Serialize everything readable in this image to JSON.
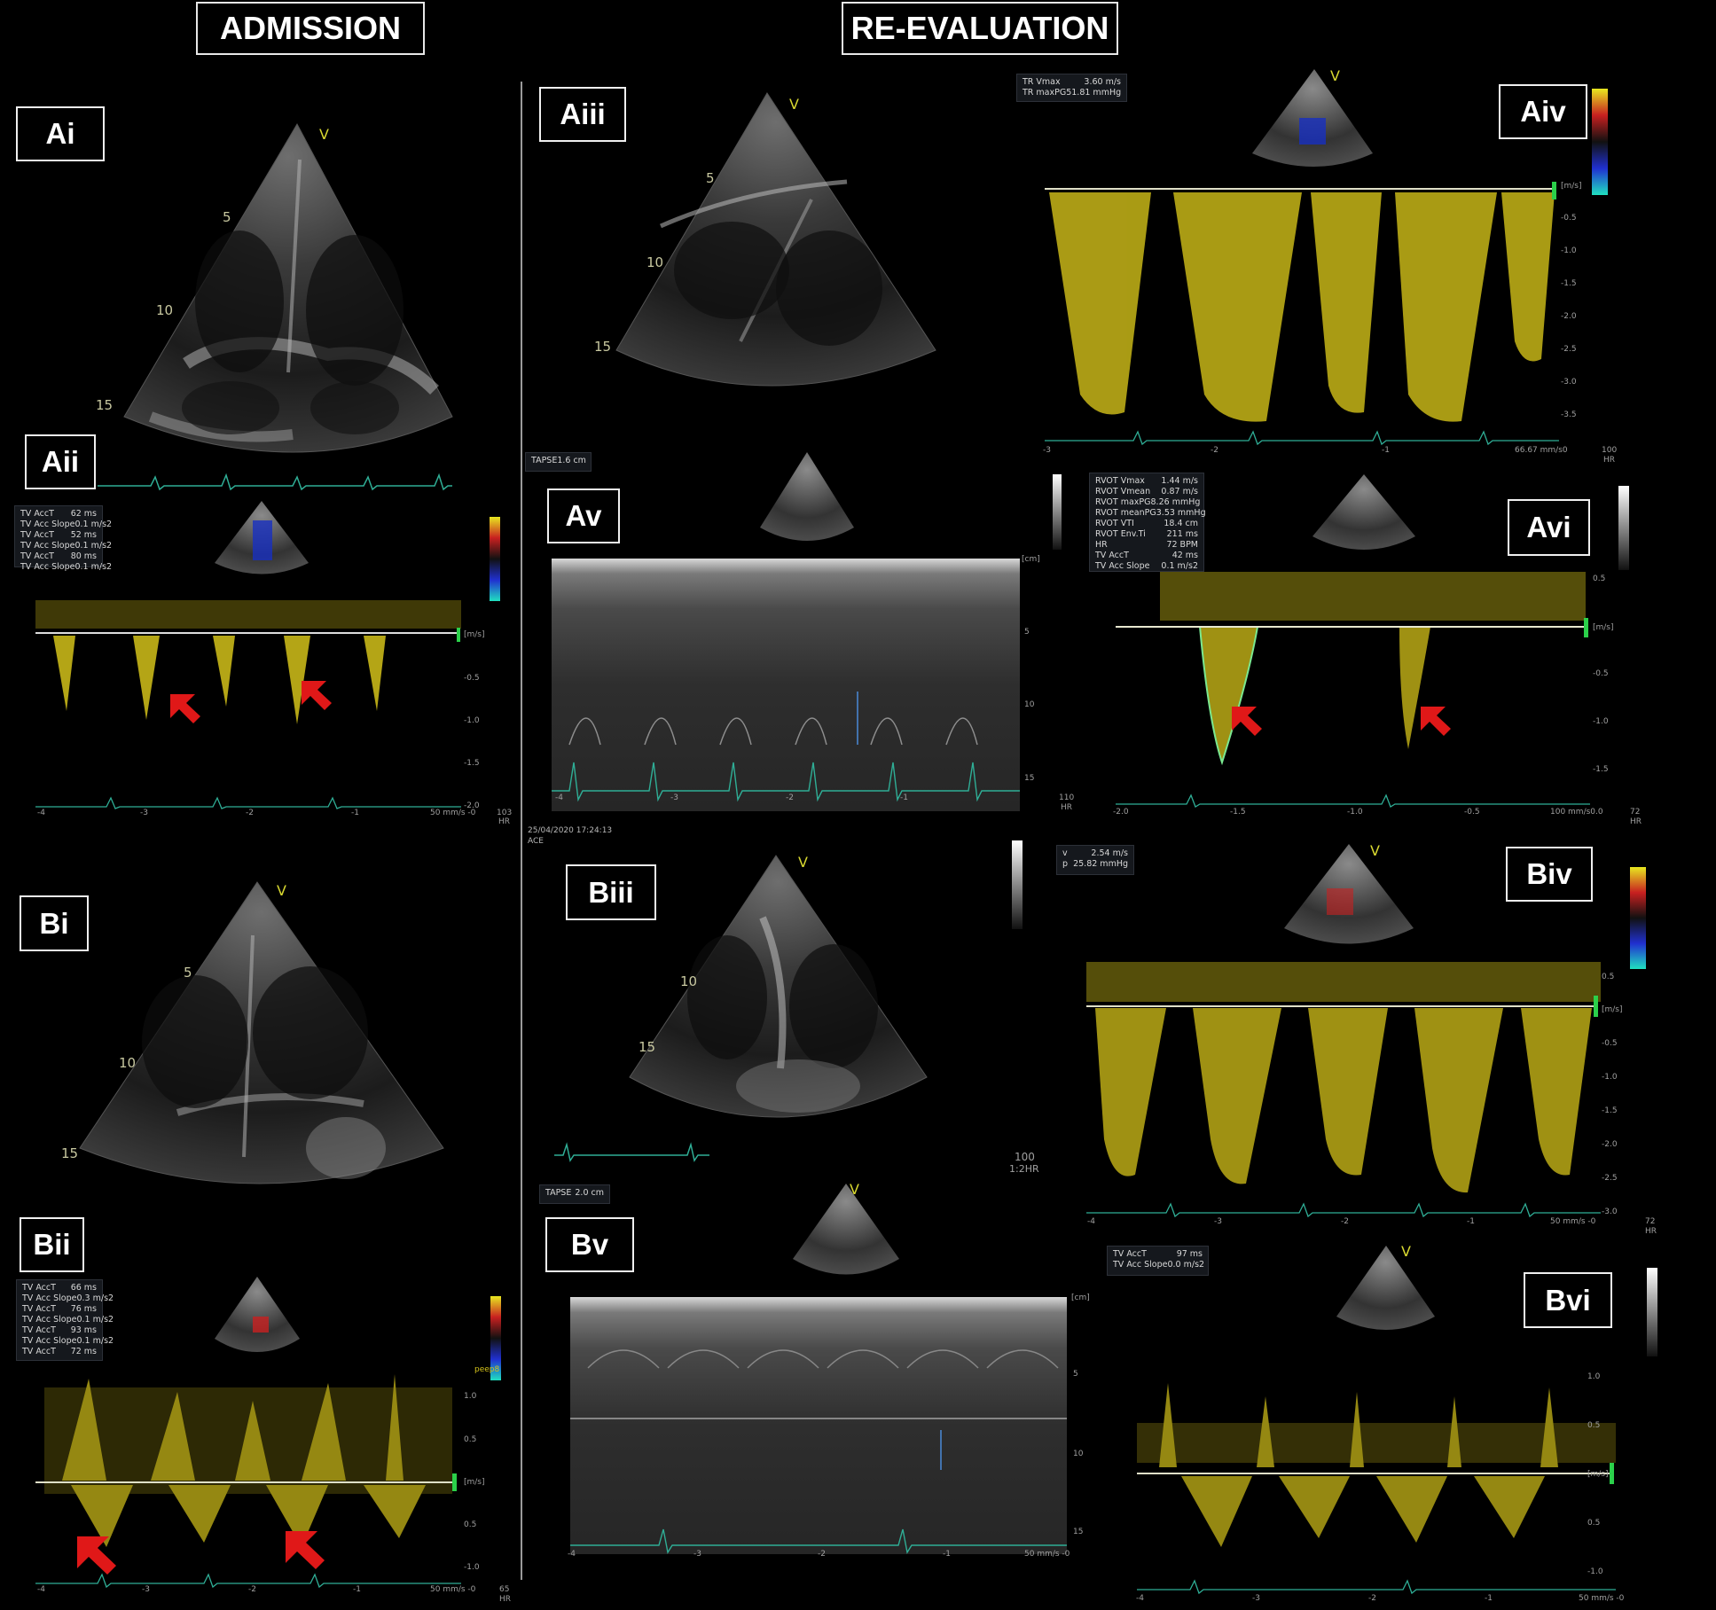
{
  "headers": {
    "admission": "ADMISSION",
    "reevaluation": "RE-EVALUATION"
  },
  "panels": {
    "ai": "Ai",
    "aii": "Aii",
    "aiii": "Aiii",
    "aiv": "Aiv",
    "av": "Av",
    "avi": "Avi",
    "bi": "Bi",
    "bii": "Bii",
    "biii": "Biii",
    "biv": "Biv",
    "bv": "Bv",
    "bvi": "Bvi"
  },
  "depth_marks": {
    "ai": [
      "5",
      "10",
      "15"
    ],
    "aiii": [
      "5",
      "10",
      "15"
    ],
    "bi": [
      "5",
      "10",
      "15"
    ],
    "biii": [
      "10",
      "15"
    ]
  },
  "measurements": {
    "aii": [
      [
        "TV AccT",
        "62 ms"
      ],
      [
        "TV Acc Slope",
        "0.1 m/s2"
      ],
      [
        "TV AccT",
        "52 ms"
      ],
      [
        "TV Acc Slope",
        "0.1 m/s2"
      ],
      [
        "TV AccT",
        "80 ms"
      ],
      [
        "TV Acc Slope",
        "0.1 m/s2"
      ]
    ],
    "aiv": [
      [
        "TR Vmax",
        "3.60 m/s"
      ],
      [
        "TR maxPG",
        "51.81 mmHg"
      ]
    ],
    "aiii_tapse": [
      [
        "TAPSE",
        "1.6 cm"
      ]
    ],
    "avi": [
      [
        "RVOT Vmax",
        "1.44 m/s"
      ],
      [
        "RVOT Vmean",
        "0.87 m/s"
      ],
      [
        "RVOT maxPG",
        "8.26 mmHg"
      ],
      [
        "RVOT meanPG",
        "3.53 mmHg"
      ],
      [
        "RVOT VTI",
        "18.4 cm"
      ],
      [
        "RVOT Env.Ti",
        "211 ms"
      ],
      [
        "HR",
        "72 BPM"
      ],
      [
        "TV AccT",
        "42 ms"
      ],
      [
        "TV Acc Slope",
        "0.1 m/s2"
      ]
    ],
    "biv": [
      [
        "v",
        "2.54 m/s"
      ],
      [
        "p",
        "25.82 mmHg"
      ]
    ],
    "bii": [
      [
        "TV AccT",
        "66 ms"
      ],
      [
        "TV Acc Slope",
        "0.3 m/s2"
      ],
      [
        "TV AccT",
        "76 ms"
      ],
      [
        "TV Acc Slope",
        "0.1 m/s2"
      ],
      [
        "TV AccT",
        "93 ms"
      ],
      [
        "TV Acc Slope",
        "0.1 m/s2"
      ],
      [
        "TV AccT",
        "72 ms"
      ],
      [
        "TV Acc Slope",
        "0.1 m/s2"
      ]
    ],
    "bv_tapse": [
      [
        "TAPSE",
        "2.0 cm"
      ]
    ],
    "bvi": [
      [
        "TV AccT",
        "97 ms"
      ],
      [
        "TV Acc Slope",
        "0.0 m/s2"
      ]
    ]
  },
  "misc": {
    "timestamp": "25/04/2020 17:24:13",
    "ace": "ACE",
    "peep": "peep8",
    "hr_aii": "103",
    "hr_av": "110",
    "hr_avi": "72",
    "hr_aiv": "100",
    "hr_biii": "100",
    "hr_biii_sub": "1:2HR",
    "hr_biv": "72",
    "hr_bii": "65",
    "hr_label": "HR",
    "speed_aiv": "66.67 mm/s0",
    "speed_50": "50 mm/s -0",
    "speed_avi": "100 mm/s0.0",
    "unit_ms": "[m/s]",
    "unit_cm": "[cm]",
    "v": "V"
  },
  "axes": {
    "aiv_y": [
      "-0.5",
      "-1.0",
      "-1.5",
      "-2.0",
      "-2.5",
      "-3.0",
      "-3.5"
    ],
    "aiv_x": [
      "-3",
      "-2",
      "-1"
    ],
    "aii_y": [
      "-0.5",
      "-1.0",
      "-1.5",
      "-2.0"
    ],
    "aii_x": [
      "-4",
      "-3",
      "-2",
      "-1"
    ],
    "av_y": [
      "5",
      "10",
      "15"
    ],
    "av_x": [
      "-4",
      "-3",
      "-2",
      "-1"
    ],
    "avi_y": [
      "0.5",
      "-0.5",
      "-1.0",
      "-1.5"
    ],
    "avi_x": [
      "-2.0",
      "-1.5",
      "-1.0",
      "-0.5"
    ],
    "biv_y": [
      "0.5",
      "-0.5",
      "-1.0",
      "-1.5",
      "-2.0",
      "-2.5",
      "-3.0"
    ],
    "biv_x": [
      "-4",
      "-3",
      "-2",
      "-1"
    ],
    "bii_y": [
      "1.0",
      "0.5",
      "0.5",
      "-1.0"
    ],
    "bii_x": [
      "-4",
      "-3",
      "-2",
      "-1"
    ],
    "bv_y": [
      "5",
      "10",
      "15"
    ],
    "bv_x": [
      "-4",
      "-3",
      "-2",
      "-1"
    ],
    "bvi_y": [
      "1.0",
      "0.5",
      "0.5",
      "-1.0"
    ],
    "bvi_x": [
      "-4",
      "-3",
      "-2",
      "-1"
    ]
  },
  "colors": {
    "doppler": "#d4c21a",
    "ecg": "#2fae96",
    "arrow": "#e01818",
    "label_border": "#f0f0f0"
  }
}
